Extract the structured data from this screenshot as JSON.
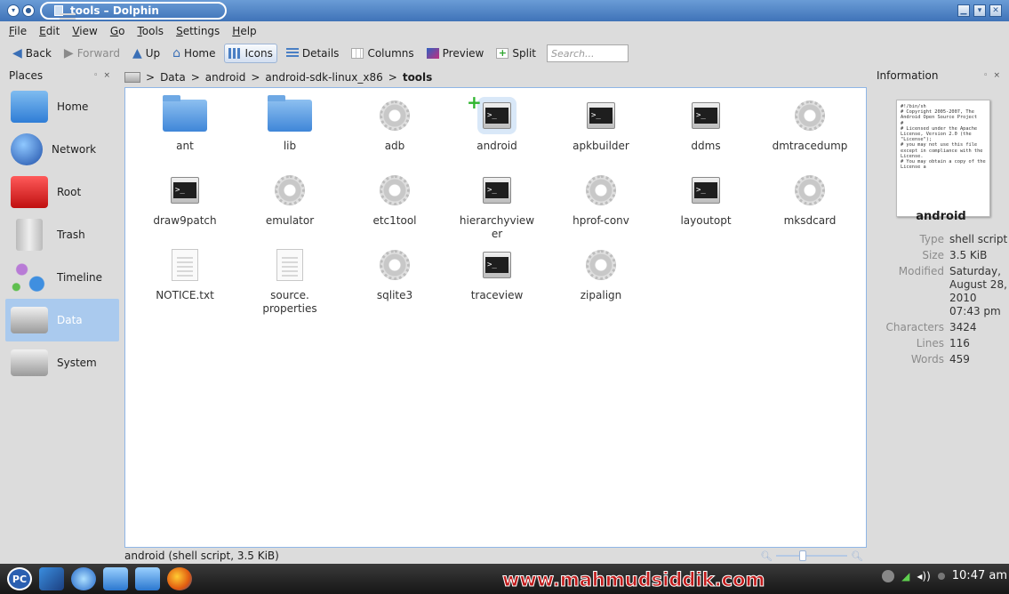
{
  "window": {
    "title": "tools – Dolphin"
  },
  "menu": [
    "File",
    "Edit",
    "View",
    "Go",
    "Tools",
    "Settings",
    "Help"
  ],
  "toolbar": {
    "back": "Back",
    "forward": "Forward",
    "up": "Up",
    "home": "Home",
    "icons": "Icons",
    "details": "Details",
    "columns": "Columns",
    "preview": "Preview",
    "split": "Split",
    "search_placeholder": "Search..."
  },
  "places": {
    "title": "Places",
    "items": [
      {
        "label": "Home",
        "icon": "home-folder-icon"
      },
      {
        "label": "Network",
        "icon": "network-globe-icon"
      },
      {
        "label": "Root",
        "icon": "root-folder-icon"
      },
      {
        "label": "Trash",
        "icon": "trash-icon"
      },
      {
        "label": "Timeline",
        "icon": "timeline-icon"
      },
      {
        "label": "Data",
        "icon": "drive-icon",
        "selected": true
      },
      {
        "label": "System",
        "icon": "drive-icon"
      }
    ]
  },
  "breadcrumb": {
    "parts": [
      "Data",
      "android",
      "android-sdk-linux_x86"
    ],
    "current": "tools"
  },
  "files": [
    {
      "name": "ant",
      "type": "folder"
    },
    {
      "name": "lib",
      "type": "folder"
    },
    {
      "name": "adb",
      "type": "gear"
    },
    {
      "name": "android",
      "type": "terminal",
      "hover": true
    },
    {
      "name": "apkbuilder",
      "type": "terminal"
    },
    {
      "name": "ddms",
      "type": "terminal"
    },
    {
      "name": "dmtracedump",
      "type": "gear"
    },
    {
      "name": "draw9patch",
      "type": "terminal"
    },
    {
      "name": "emulator",
      "type": "gear"
    },
    {
      "name": "etc1tool",
      "type": "gear"
    },
    {
      "name": "hierarchyview\ner",
      "type": "terminal"
    },
    {
      "name": "hprof-conv",
      "type": "gear"
    },
    {
      "name": "layoutopt",
      "type": "terminal"
    },
    {
      "name": "mksdcard",
      "type": "gear"
    },
    {
      "name": "NOTICE.txt",
      "type": "text"
    },
    {
      "name": "source.\nproperties",
      "type": "text"
    },
    {
      "name": "sqlite3",
      "type": "gear"
    },
    {
      "name": "traceview",
      "type": "terminal"
    },
    {
      "name": "zipalign",
      "type": "gear"
    }
  ],
  "status": {
    "text": "android (shell script, 3.5 KiB)"
  },
  "info": {
    "title": "Information",
    "preview_text": "#!/bin/sh\n# Copyright 2005-2007, The Android Open Source Project\n#\n# Licensed under the Apache License, Version 2.0 (the \"License\");\n# you may not use this file except in compliance with the License.\n# You may obtain a copy of the License a",
    "name": "android",
    "rows": [
      {
        "k": "Type",
        "v": "shell script"
      },
      {
        "k": "Size",
        "v": "3.5 KiB"
      },
      {
        "k": "Modified",
        "v": "Saturday, August 28, 2010 07:43 pm"
      },
      {
        "k": "Characters",
        "v": "3424"
      },
      {
        "k": "Lines",
        "v": "116"
      },
      {
        "k": "Words",
        "v": "459"
      }
    ]
  },
  "taskbar": {
    "watermark": "www.mahmudsiddik.com",
    "clock": "10:47 am",
    "pc_label": "PC"
  }
}
